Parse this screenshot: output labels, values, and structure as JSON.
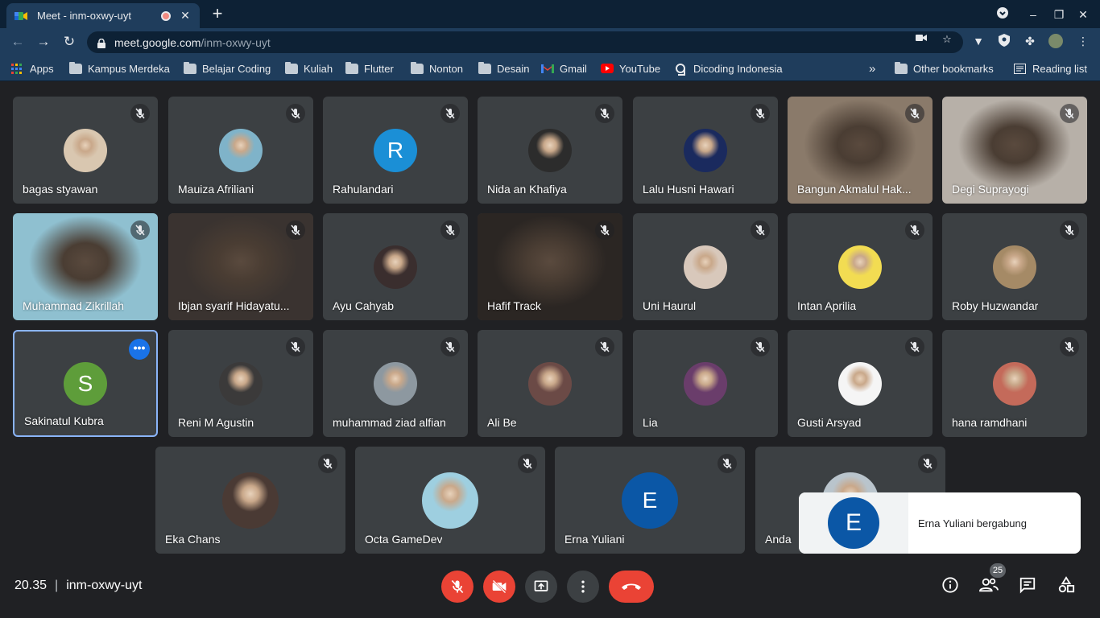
{
  "browser": {
    "tab_title": "Meet - inm-oxwy-uyt",
    "url_host": "meet.google.com",
    "url_path": "/inm-oxwy-uyt",
    "bookmarks": [
      "Apps",
      "Kampus Merdeka",
      "Belajar Coding",
      "Kuliah",
      "Flutter",
      "Nonton",
      "Desain",
      "Gmail",
      "YouTube",
      "Dicoding Indonesia"
    ],
    "overflow": "»",
    "other_bookmarks": "Other bookmarks",
    "reading_list": "Reading list"
  },
  "participants": [
    {
      "name": "bagas styawan",
      "kind": "photo",
      "color": "#d9c7b0"
    },
    {
      "name": "Mauiza Afriliani",
      "kind": "photo",
      "color": "#7fb3c9"
    },
    {
      "name": "Rahulandari",
      "kind": "letter",
      "letter": "R",
      "color": "#1b8fd6"
    },
    {
      "name": "Nida an Khafiya",
      "kind": "photo",
      "color": "#2c2c2c"
    },
    {
      "name": "Lalu Husni Hawari",
      "kind": "photo",
      "color": "#1a2a5e"
    },
    {
      "name": "Bangun Akmalul Hak...",
      "kind": "video",
      "color": "#8a7a6a"
    },
    {
      "name": "Degi Suprayogi",
      "kind": "video",
      "color": "#b7b0a8"
    },
    {
      "name": "Muhammad Zikrillah",
      "kind": "video",
      "color": "#8fc0d0"
    },
    {
      "name": "Ibjan syarif Hidayatu...",
      "kind": "video",
      "color": "#3a3330"
    },
    {
      "name": "Ayu Cahyab",
      "kind": "photo",
      "color": "#3a2e2e"
    },
    {
      "name": "Hafif Track",
      "kind": "video",
      "color": "#2b2623"
    },
    {
      "name": "Uni Haurul",
      "kind": "photo",
      "color": "#d8c8bb"
    },
    {
      "name": "Intan Aprilia",
      "kind": "photo",
      "color": "#f2dc52"
    },
    {
      "name": "Roby Huzwandar",
      "kind": "photo",
      "color": "#a58a66"
    },
    {
      "name": "Sakinatul Kubra",
      "kind": "letter",
      "letter": "S",
      "color": "#5e9d3a"
    },
    {
      "name": "Reni M Agustin",
      "kind": "photo",
      "color": "#3b3a3a"
    },
    {
      "name": "muhammad ziad alfian",
      "kind": "photo",
      "color": "#8d98a0"
    },
    {
      "name": "Ali Be",
      "kind": "photo",
      "color": "#6b4a46"
    },
    {
      "name": "Lia",
      "kind": "photo",
      "color": "#6a3d6b"
    },
    {
      "name": "Gusti Arsyad",
      "kind": "photo",
      "color": "#f5f5f5"
    },
    {
      "name": "hana ramdhani",
      "kind": "photo",
      "color": "#c46a5a"
    },
    {
      "name": "Eka Chans",
      "kind": "photo",
      "color": "#4a3a34"
    },
    {
      "name": "Octa GameDev",
      "kind": "photo",
      "color": "#9ecfe0"
    },
    {
      "name": "Erna Yuliani",
      "kind": "letter",
      "letter": "E",
      "color": "#0b57a6"
    },
    {
      "name": "Anda",
      "kind": "photo",
      "color": "#b9c4cc"
    }
  ],
  "toast": {
    "letter": "E",
    "message": "Erna Yuliani bergabung"
  },
  "bottom": {
    "time": "20.35",
    "separator": "|",
    "meeting_code": "inm-oxwy-uyt",
    "people_count": "25"
  }
}
